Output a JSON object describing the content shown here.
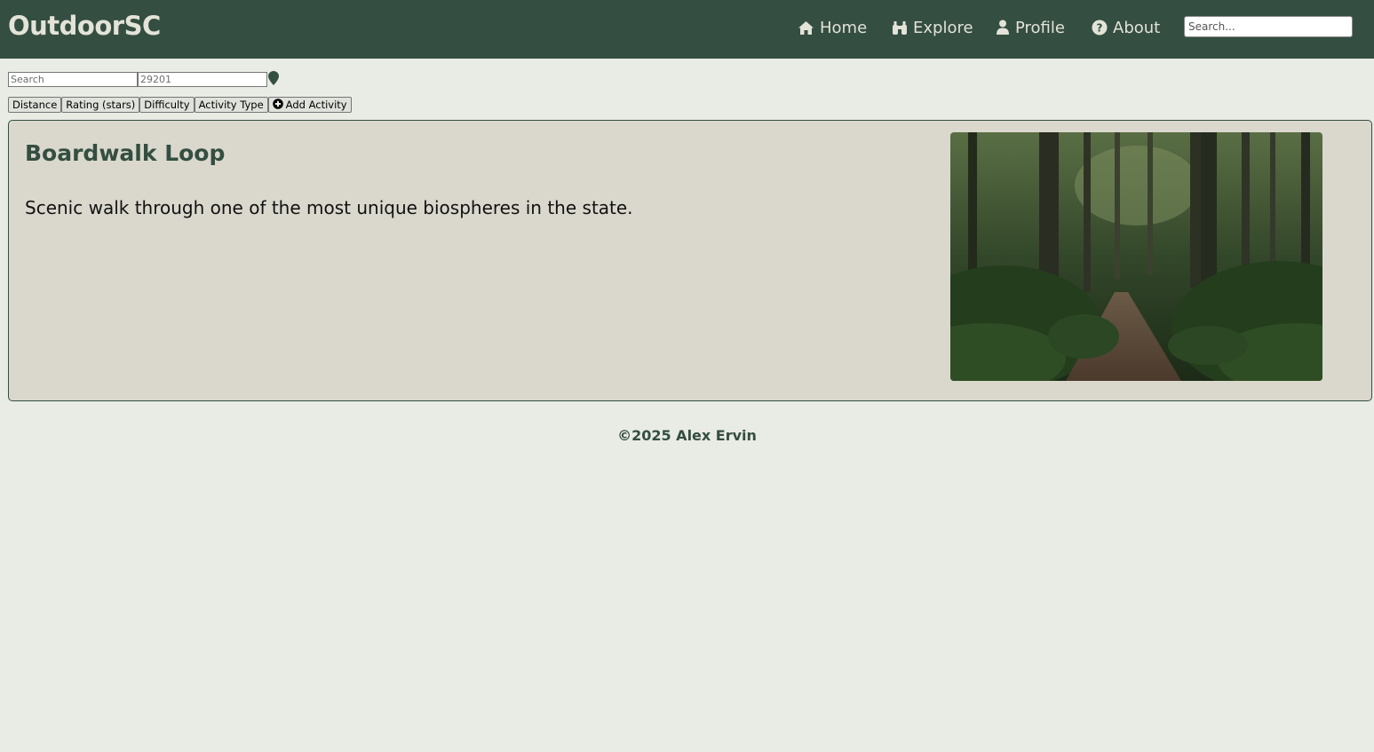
{
  "header": {
    "brand": "OutdoorSC",
    "nav": [
      {
        "label": "Home",
        "icon": "home-icon"
      },
      {
        "label": "Explore",
        "icon": "binoculars-icon"
      },
      {
        "label": "Profile",
        "icon": "user-icon"
      },
      {
        "label": "About",
        "icon": "question-circle-icon"
      }
    ],
    "search_placeholder": "Search..."
  },
  "filters": {
    "search_placeholder": "Search",
    "zip_placeholder": "29201",
    "location_icon": "map-pin-icon",
    "buttons": [
      {
        "label": "Distance"
      },
      {
        "label": "Rating (stars)"
      },
      {
        "label": "Difficulty"
      },
      {
        "label": "Activity Type"
      },
      {
        "label": "Add Activity",
        "icon": "plus-circle-icon"
      }
    ]
  },
  "activity": {
    "title": "Boardwalk Loop",
    "description": "Scenic walk through one of the most unique biospheres in the state."
  },
  "footer": {
    "text": "©2025 Alex Ervin"
  },
  "colors": {
    "header_bg": "#344e41",
    "page_bg": "#e9ebe5",
    "card_bg": "#dad8cd",
    "accent": "#344e41",
    "header_text": "#e3e3d8"
  }
}
